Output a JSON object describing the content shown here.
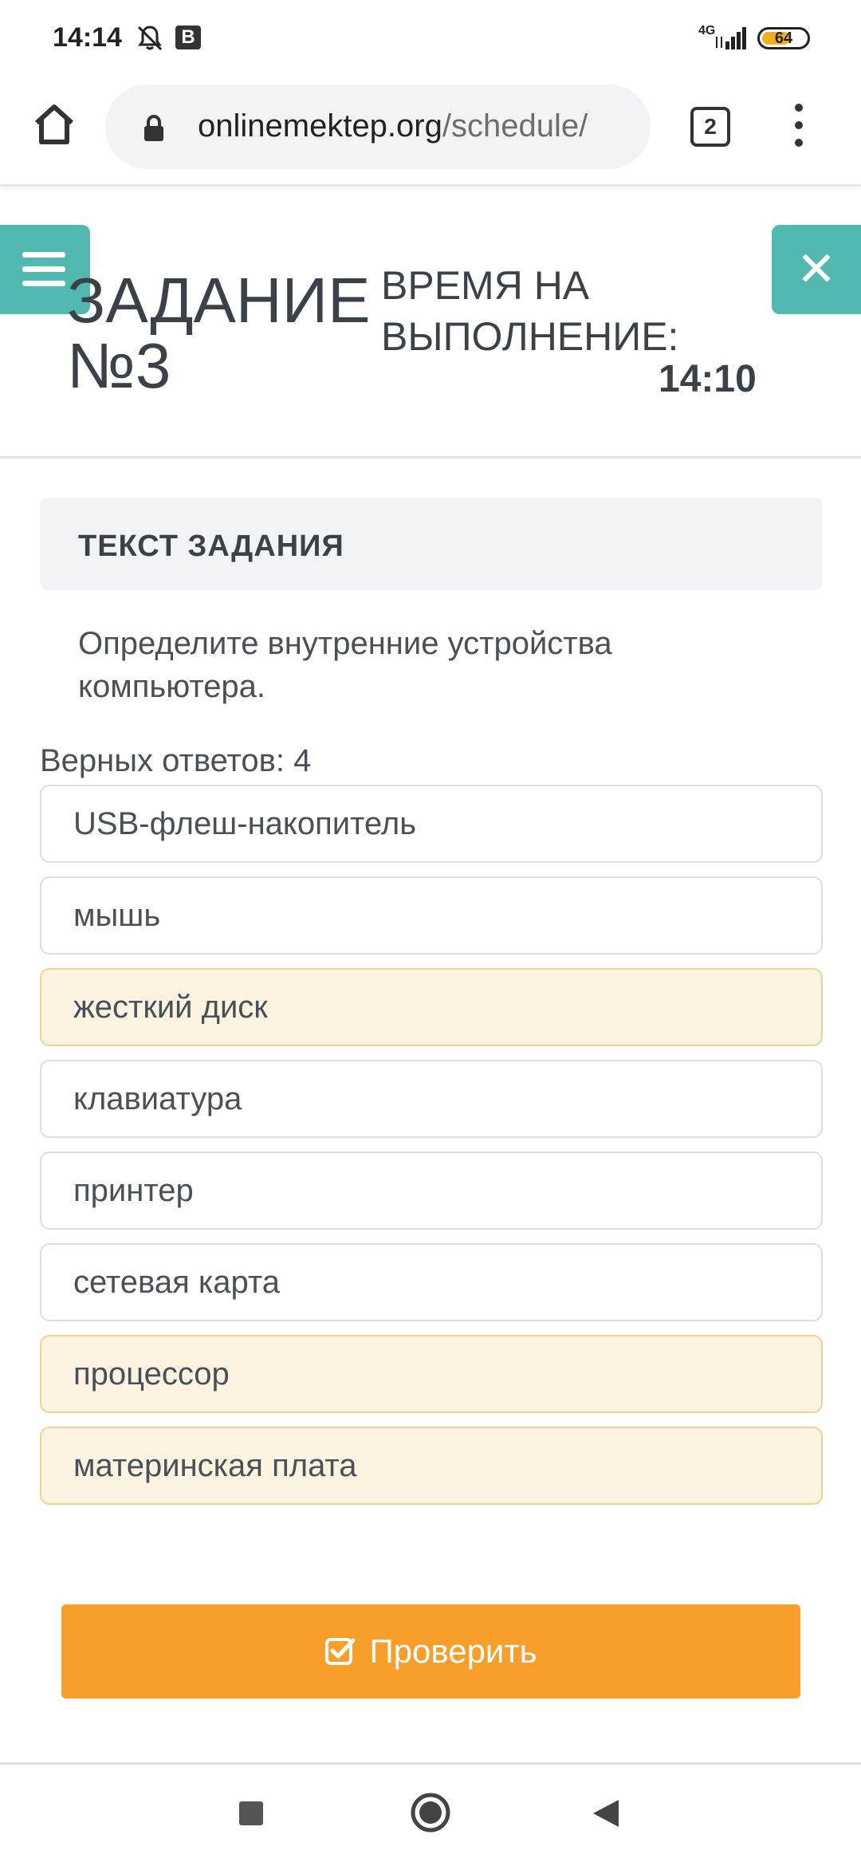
{
  "status_bar": {
    "time": "14:14",
    "network": "4G",
    "battery": "64",
    "battery_level": 0.64,
    "icons": [
      "bell-off-icon",
      "b-app-icon",
      "signal-icon",
      "battery-icon"
    ]
  },
  "browser": {
    "url_domain": "onlinemektep.org",
    "url_path": "/schedule/",
    "tab_count": "2",
    "icons": [
      "home-icon",
      "lock-icon",
      "more-vert-icon"
    ]
  },
  "header": {
    "task_title": "ЗАДАНИЕ №3",
    "time_label": "ВРЕМЯ НА ВЫПОЛНЕНИЕ:",
    "time_value": "14:10",
    "accent_color": "#52b9b0"
  },
  "task": {
    "section_label": "ТЕКСТ ЗАДАНИЯ",
    "question": "Определите внутренние устройства компьютера.",
    "answers_count": "Верных ответов: 4",
    "options": [
      {
        "label": "USB-флеш-накопитель",
        "selected": false
      },
      {
        "label": "мышь",
        "selected": false
      },
      {
        "label": "жесткий диск",
        "selected": true
      },
      {
        "label": "клавиатура",
        "selected": false
      },
      {
        "label": "принтер",
        "selected": false
      },
      {
        "label": "сетевая карта",
        "selected": false
      },
      {
        "label": "процессор",
        "selected": true
      },
      {
        "label": "материнская плата",
        "selected": true
      }
    ],
    "check_button": "Проверить",
    "check_button_color": "#f89e2b"
  }
}
